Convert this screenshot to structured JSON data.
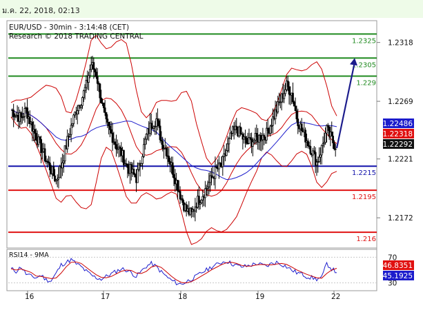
{
  "header": {
    "date_time": "ม.ค. 22, 2018, 02:13"
  },
  "chart": {
    "title": "EUR/USD - 30min - 3:14:48 (CET)",
    "credit": "Research © 2018 TRADING CENTRAL"
  },
  "colors": {
    "header_bg": "#eefbe8",
    "candles": "#000000",
    "bollinger": "#cc0000",
    "ma_fast": "#cc0000",
    "ma_slow": "#1c1ccc",
    "resistance": "#1f8a1f",
    "support": "#e01010",
    "pivot": "#1111aa",
    "arrow": "#1c1c8c",
    "rsi_line": "#1c1ccc",
    "rsi_signal": "#cc0000",
    "badge_blue": "#1c1ccc",
    "badge_red": "#e01010",
    "badge_dark": "#111111"
  },
  "chart_data": {
    "type": "candlestick",
    "symbol": "EUR/USD",
    "timeframe": "30min",
    "y_range": [
      1.2148,
      1.2335
    ],
    "y_ticks": [
      1.2318,
      1.2269,
      1.2221,
      1.2172
    ],
    "x_ticks": [
      "16",
      "17",
      "18",
      "19",
      "22"
    ],
    "resistance_levels": [
      1.2325,
      1.2305,
      1.229
    ],
    "resistance_labels": [
      "1.2325",
      "1.2305",
      "1.229"
    ],
    "pivot_level": 1.2215,
    "pivot_label": "1.2215",
    "support_levels": [
      1.2195,
      1.216
    ],
    "support_labels": [
      "1.2195",
      "1.216"
    ],
    "last_price_badges": [
      {
        "label": "1.22486",
        "value": 1.22486,
        "style": "blue"
      },
      {
        "label": "1.22318",
        "value": 1.22318,
        "style": "red"
      },
      {
        "label": "1.22292",
        "value": 1.22292,
        "style": "dark"
      }
    ],
    "price_path": [
      1.2262,
      1.2258,
      1.2255,
      1.2262,
      1.225,
      1.224,
      1.223,
      1.222,
      1.2212,
      1.2203,
      1.2215,
      1.2232,
      1.2248,
      1.2262,
      1.227,
      1.2282,
      1.23,
      1.2292,
      1.227,
      1.225,
      1.2242,
      1.2232,
      1.2226,
      1.2216,
      1.221,
      1.2205,
      1.2222,
      1.224,
      1.225,
      1.2254,
      1.2236,
      1.2228,
      1.2215,
      1.2202,
      1.2188,
      1.2178,
      1.2175,
      1.2185,
      1.219,
      1.2197,
      1.2205,
      1.2212,
      1.2215,
      1.2228,
      1.2242,
      1.2246,
      1.224,
      1.2234,
      1.2236,
      1.2238,
      1.224,
      1.2242,
      1.2252,
      1.2262,
      1.2272,
      1.2282,
      1.2276,
      1.2256,
      1.2245,
      1.2237,
      1.2228,
      1.2218,
      1.223,
      1.2245,
      1.2237,
      1.223
    ],
    "projection": {
      "from": 1.223,
      "to": 1.2305
    },
    "rsi": {
      "name": "RSI14 - 9MA",
      "levels": [
        70,
        30
      ],
      "level_labels": [
        "70",
        "30"
      ],
      "range": [
        20,
        80
      ],
      "values": [
        52,
        48,
        55,
        44,
        40,
        38,
        42,
        35,
        33,
        45,
        58,
        62,
        66,
        60,
        55,
        48,
        42,
        38,
        36,
        40,
        44,
        48,
        52,
        50,
        46,
        40,
        48,
        56,
        60,
        55,
        47,
        40,
        34,
        30,
        28,
        32,
        36,
        40,
        46,
        50,
        55,
        58,
        62,
        64,
        60,
        57,
        55,
        56,
        58,
        60,
        58,
        56,
        60,
        62,
        59,
        55,
        50,
        46,
        44,
        40,
        38,
        36,
        38,
        60,
        52,
        46
      ],
      "badges": [
        {
          "label": "46.8351",
          "value": 46.8351,
          "style": "red"
        },
        {
          "label": "45.1925",
          "value": 45.1925,
          "style": "blue"
        }
      ]
    }
  }
}
